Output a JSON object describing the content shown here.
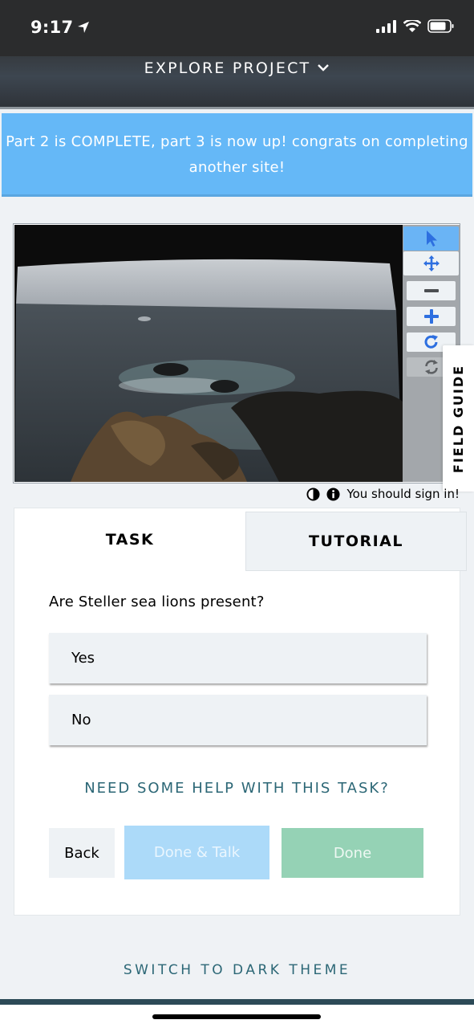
{
  "status_bar": {
    "time": "9:17"
  },
  "header": {
    "title": "EXPLORE PROJECT"
  },
  "announcement": {
    "text": "Part 2 is COMPLETE, part 3 is now up! congrats on completing another site!"
  },
  "viewer": {
    "tools": [
      "pointer-icon",
      "move-icon",
      "zoom-out-icon",
      "zoom-in-icon",
      "rotate-icon",
      "reset-icon"
    ],
    "field_guide_label": "FIELD GUIDE",
    "sign_in_notice": "You should sign in!"
  },
  "task_panel": {
    "tabs": [
      {
        "label": "TASK",
        "active": true
      },
      {
        "label": "TUTORIAL",
        "active": false
      }
    ],
    "question": "Are Steller sea lions present?",
    "answers": [
      "Yes",
      "No"
    ],
    "help_link": "NEED SOME HELP WITH THIS TASK?",
    "buttons": {
      "back": "Back",
      "done_talk": "Done & Talk",
      "done": "Done"
    }
  },
  "footer": {
    "theme_toggle": "SWITCH TO DARK THEME"
  },
  "colors": {
    "accent_blue": "#65b8f7",
    "link_teal": "#2c6776",
    "done_green": "#95d2b5"
  }
}
